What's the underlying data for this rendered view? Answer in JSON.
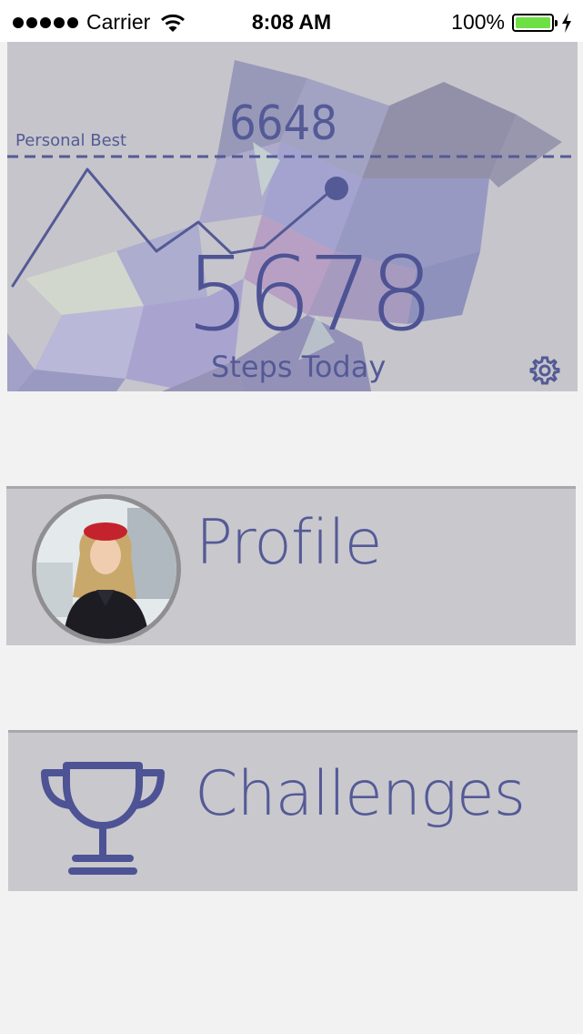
{
  "status_bar": {
    "carrier": "Carrier",
    "time": "8:08 AM",
    "battery": "100%",
    "battery_level": 1.0
  },
  "hero": {
    "personal_best_label": "Personal Best",
    "personal_best_value": "6648",
    "steps_value": "5678",
    "steps_label": "Steps Today",
    "settings_icon": "gear-icon"
  },
  "profile": {
    "label": "Profile",
    "avatar_icon": "avatar"
  },
  "challenges": {
    "label": "Challenges",
    "icon": "trophy-icon"
  },
  "colors": {
    "accent": "#545a96",
    "card_bg": "#c9c8cd",
    "page_bg": "#f2f2f2",
    "battery": "#6ee043"
  }
}
